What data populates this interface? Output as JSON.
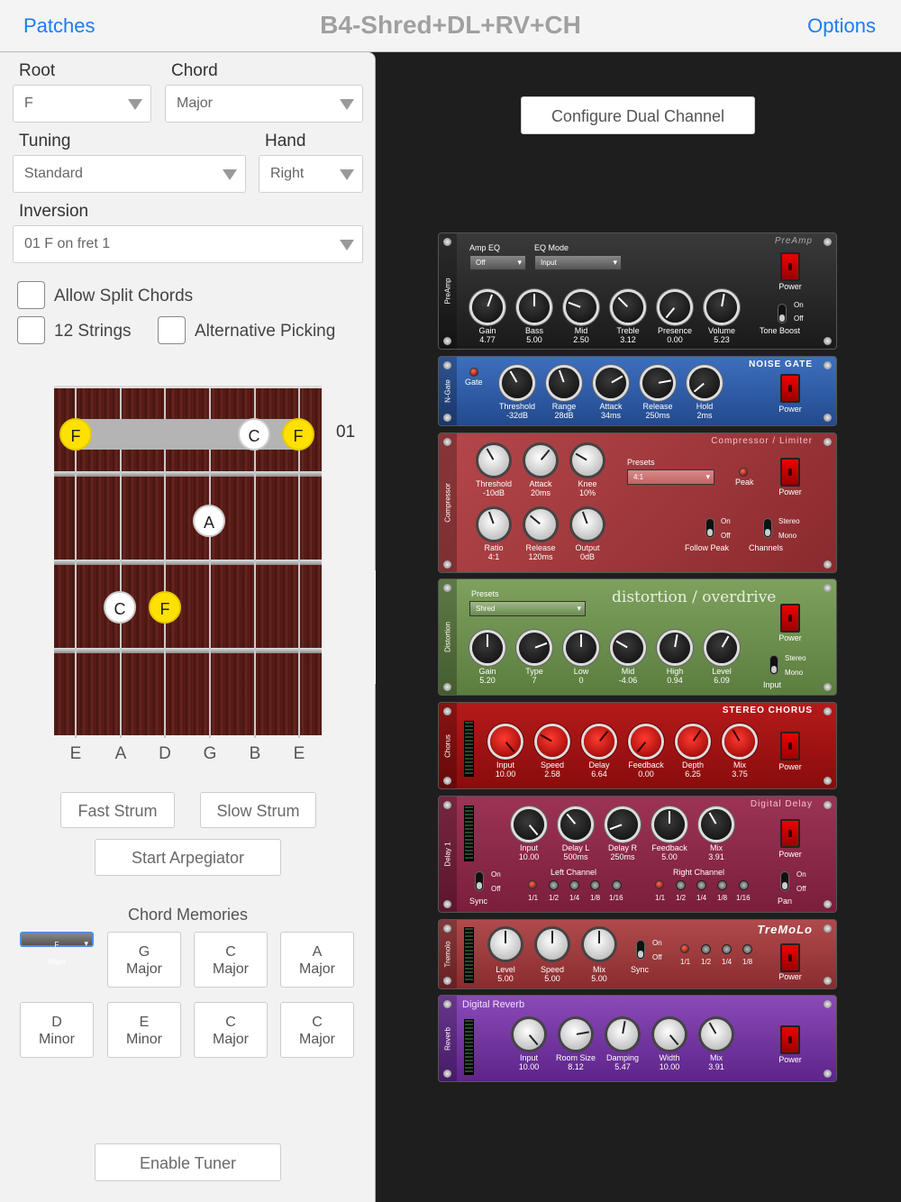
{
  "topbar": {
    "patches": "Patches",
    "title": "B4-Shred+DL+RV+CH",
    "options": "Options"
  },
  "left": {
    "root": {
      "label": "Root",
      "value": "F"
    },
    "chord": {
      "label": "Chord",
      "value": "Major"
    },
    "tuning": {
      "label": "Tuning",
      "value": "Standard"
    },
    "hand": {
      "label": "Hand",
      "value": "Right"
    },
    "inversion": {
      "label": "Inversion",
      "value": "01 F on fret 1"
    },
    "checks": {
      "split": "Allow Split Chords",
      "twelve": "12 Strings",
      "alt": "Alternative Picking"
    },
    "fret_number": "01",
    "notes": {
      "n1": "F",
      "n2": "C",
      "n3": "F",
      "n4": "A",
      "n5": "C",
      "n6": "F"
    },
    "strings": [
      "E",
      "A",
      "D",
      "G",
      "B",
      "E"
    ],
    "buttons": {
      "fast": "Fast Strum",
      "slow": "Slow Strum",
      "arp": "Start Arpegiator",
      "tuner": "Enable Tuner"
    },
    "memories_title": "Chord Memories",
    "memories": [
      {
        "n": "F",
        "q": "Major"
      },
      {
        "n": "G",
        "q": "Major"
      },
      {
        "n": "C",
        "q": "Major"
      },
      {
        "n": "A",
        "q": "Major"
      },
      {
        "n": "D",
        "q": "Minor"
      },
      {
        "n": "E",
        "q": "Minor"
      },
      {
        "n": "C",
        "q": "Major"
      },
      {
        "n": "C",
        "q": "Major"
      }
    ]
  },
  "rack": {
    "configure": "Configure Dual Channel",
    "preamp": {
      "side": "PreAmp",
      "hdr": "PreAmp",
      "ampeq_label": "Amp EQ",
      "ampeq": "Off",
      "eqmode_label": "EQ Mode",
      "eqmode": "Input",
      "power": "Power",
      "on": "On",
      "off": "Off",
      "tone": "Tone Boost",
      "k": [
        {
          "n": "Gain",
          "v": "4.77"
        },
        {
          "n": "Bass",
          "v": "5.00"
        },
        {
          "n": "Mid",
          "v": "2.50"
        },
        {
          "n": "Treble",
          "v": "3.12"
        },
        {
          "n": "Presence",
          "v": "0.00"
        },
        {
          "n": "Volume",
          "v": "5.23"
        }
      ]
    },
    "gate": {
      "side": "N-Gate",
      "hdr": "NOISE GATE",
      "gate": "Gate",
      "power": "Power",
      "k": [
        {
          "n": "Threshold",
          "v": "-32dB"
        },
        {
          "n": "Range",
          "v": "28dB"
        },
        {
          "n": "Attack",
          "v": "34ms"
        },
        {
          "n": "Release",
          "v": "250ms"
        },
        {
          "n": "Hold",
          "v": "2ms"
        }
      ]
    },
    "comp": {
      "side": "Compressor",
      "hdr": "Compressor / Limiter",
      "presets": "Presets",
      "preset": "4:1",
      "peak": "Peak",
      "power": "Power",
      "on": "On",
      "off": "Off",
      "follow": "Follow Peak",
      "stereo": "Stereo",
      "mono": "Mono",
      "channels": "Channels",
      "k1": [
        {
          "n": "Threshold",
          "v": "-10dB"
        },
        {
          "n": "Attack",
          "v": "20ms"
        },
        {
          "n": "Knee",
          "v": "10%"
        }
      ],
      "k2": [
        {
          "n": "Ratio",
          "v": "4:1"
        },
        {
          "n": "Release",
          "v": "120ms"
        },
        {
          "n": "Output",
          "v": "0dB"
        }
      ]
    },
    "dist": {
      "side": "Distortion",
      "hdr": "distortion / overdrive",
      "presets": "Presets",
      "preset": "Shred",
      "power": "Power",
      "stereo": "Stereo",
      "mono": "Mono",
      "input": "Input",
      "k": [
        {
          "n": "Gain",
          "v": "5.20"
        },
        {
          "n": "Type",
          "v": "7"
        },
        {
          "n": "Low",
          "v": "0"
        },
        {
          "n": "Mid",
          "v": "-4.06"
        },
        {
          "n": "High",
          "v": "0.94"
        },
        {
          "n": "Level",
          "v": "6.09"
        }
      ]
    },
    "chorus": {
      "side": "Chorus",
      "hdr": "STEREO CHORUS",
      "power": "Power",
      "k": [
        {
          "n": "Input",
          "v": "10.00"
        },
        {
          "n": "Speed",
          "v": "2.58"
        },
        {
          "n": "Delay",
          "v": "6.64"
        },
        {
          "n": "Feedback",
          "v": "0.00"
        },
        {
          "n": "Depth",
          "v": "6.25"
        },
        {
          "n": "Mix",
          "v": "3.75"
        }
      ]
    },
    "delay": {
      "side": "Delay 1",
      "hdr": "Digital Delay",
      "power": "Power",
      "on": "On",
      "off": "Off",
      "sync": "Sync",
      "left": "Left Channel",
      "right": "Right Channel",
      "pan": "Pan",
      "div": [
        "1/1",
        "1/2",
        "1/4",
        "1/8",
        "1/16"
      ],
      "k": [
        {
          "n": "Input",
          "v": "10.00"
        },
        {
          "n": "Delay L",
          "v": "500ms"
        },
        {
          "n": "Delay R",
          "v": "250ms"
        },
        {
          "n": "Feedback",
          "v": "5.00"
        },
        {
          "n": "Mix",
          "v": "3.91"
        }
      ]
    },
    "trem": {
      "side": "Tremolo",
      "hdr": "TreMoLo",
      "power": "Power",
      "on": "On",
      "off": "Off",
      "sync": "Sync",
      "div": [
        "1/1",
        "1/2",
        "1/4",
        "1/8"
      ],
      "k": [
        {
          "n": "Level",
          "v": "5.00"
        },
        {
          "n": "Speed",
          "v": "5.00"
        },
        {
          "n": "Mix",
          "v": "5.00"
        }
      ]
    },
    "reverb": {
      "side": "Reverb",
      "hdr": "Digital Reverb",
      "power": "Power",
      "k": [
        {
          "n": "Input",
          "v": "10.00"
        },
        {
          "n": "Room Size",
          "v": "8.12"
        },
        {
          "n": "Damping",
          "v": "5.47"
        },
        {
          "n": "Width",
          "v": "10.00"
        },
        {
          "n": "Mix",
          "v": "3.91"
        }
      ]
    }
  },
  "colors": {
    "accent": "#1a7cf2",
    "root_note": "#ffe100",
    "preamp": "#2a2a2a",
    "gate": "#2f5fae",
    "comp": "#a8383c",
    "dist": "#6c8e4e",
    "chorus": "#a51616",
    "delay": "#8e2a48",
    "trem": "#9a3a3c",
    "reverb": "#7a3aa6"
  }
}
